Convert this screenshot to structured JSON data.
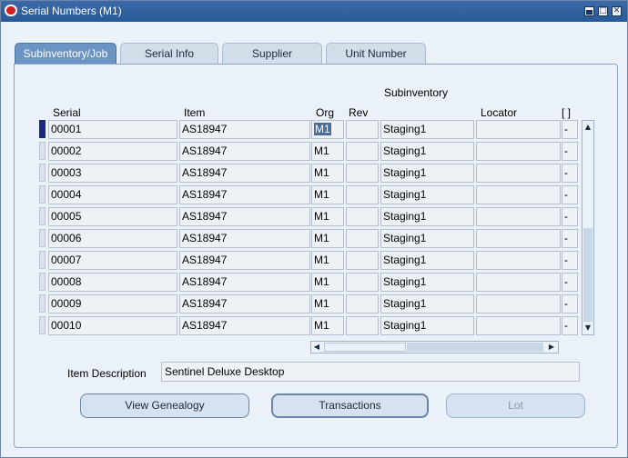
{
  "window": {
    "title": "Serial Numbers (M1)"
  },
  "tabs": [
    {
      "label": "Subinventory/Job",
      "active": true
    },
    {
      "label": "Serial Info",
      "active": false
    },
    {
      "label": "Supplier",
      "active": false
    },
    {
      "label": "Unit Number",
      "active": false
    }
  ],
  "grid": {
    "headers": {
      "serial": "Serial",
      "item": "Item",
      "org": "Org",
      "rev": "Rev",
      "subinventory": "Subinventory",
      "locator": "Locator",
      "flex": "[ ]"
    },
    "rows": [
      {
        "serial": "00001",
        "item": "AS18947",
        "org": "M1",
        "rev": "",
        "subinventory": "Staging1",
        "locator": "",
        "flex": "-"
      },
      {
        "serial": "00002",
        "item": "AS18947",
        "org": "M1",
        "rev": "",
        "subinventory": "Staging1",
        "locator": "",
        "flex": "-"
      },
      {
        "serial": "00003",
        "item": "AS18947",
        "org": "M1",
        "rev": "",
        "subinventory": "Staging1",
        "locator": "",
        "flex": "-"
      },
      {
        "serial": "00004",
        "item": "AS18947",
        "org": "M1",
        "rev": "",
        "subinventory": "Staging1",
        "locator": "",
        "flex": "-"
      },
      {
        "serial": "00005",
        "item": "AS18947",
        "org": "M1",
        "rev": "",
        "subinventory": "Staging1",
        "locator": "",
        "flex": "-"
      },
      {
        "serial": "00006",
        "item": "AS18947",
        "org": "M1",
        "rev": "",
        "subinventory": "Staging1",
        "locator": "",
        "flex": "-"
      },
      {
        "serial": "00007",
        "item": "AS18947",
        "org": "M1",
        "rev": "",
        "subinventory": "Staging1",
        "locator": "",
        "flex": "-"
      },
      {
        "serial": "00008",
        "item": "AS18947",
        "org": "M1",
        "rev": "",
        "subinventory": "Staging1",
        "locator": "",
        "flex": "-"
      },
      {
        "serial": "00009",
        "item": "AS18947",
        "org": "M1",
        "rev": "",
        "subinventory": "Staging1",
        "locator": "",
        "flex": "-"
      },
      {
        "serial": "00010",
        "item": "AS18947",
        "org": "M1",
        "rev": "",
        "subinventory": "Staging1",
        "locator": "",
        "flex": "-"
      }
    ]
  },
  "item_description": {
    "label": "Item Description",
    "value": "Sentinel Deluxe Desktop"
  },
  "buttons": {
    "view_genealogy": "View Genealogy",
    "transactions": "Transactions",
    "lot": "Lot"
  },
  "colors": {
    "titlebar": "#285a97",
    "active_tab": "#6c94c3",
    "panel": "#eaf1f8"
  }
}
